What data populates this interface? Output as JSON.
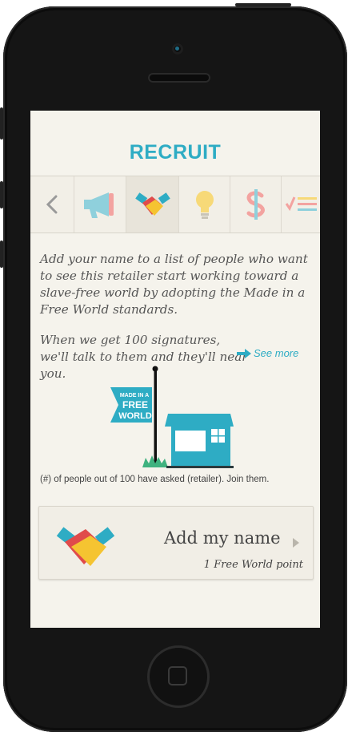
{
  "header": {
    "title": "RECRUIT"
  },
  "icon_bar": {
    "icons": [
      "chevron-left-icon",
      "megaphone-icon",
      "handshake-icon",
      "lightbulb-icon",
      "dollar-icon",
      "checklist-icon"
    ],
    "active": "handshake-icon"
  },
  "content": {
    "paragraph1": "Add your name to a list of people who want to see this retailer start working toward a slave-free world by adopting the Made in a Free World standards.",
    "paragraph2": "When we get 100 signatures, we'll talk to them and they'll near you.",
    "see_more": "See more",
    "flag_text": [
      "MADE IN A",
      "FREE",
      "WORLD"
    ],
    "count_text": "(#) of people out of 100 have asked (retailer). Join them."
  },
  "action_card": {
    "title": "Add my name",
    "subtitle": "1 Free World point"
  },
  "colors": {
    "accent": "#2eacc4",
    "background": "#f5f3ec",
    "red": "#e04b4b",
    "yellow": "#f5c431",
    "green": "#3fb27f"
  }
}
